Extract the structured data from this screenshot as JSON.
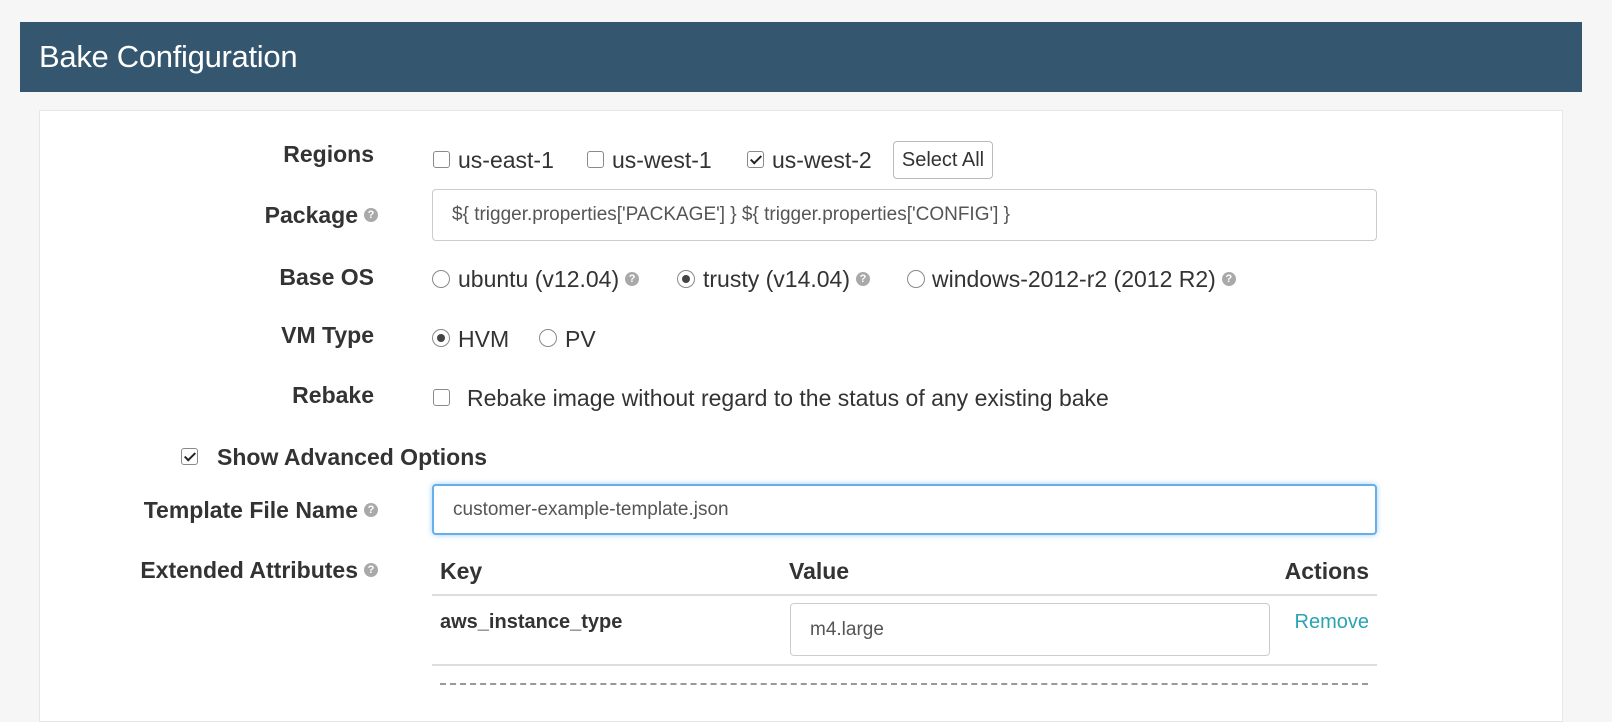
{
  "header": {
    "title": "Bake Configuration"
  },
  "regions": {
    "label": "Regions",
    "options": [
      {
        "label": "us-east-1",
        "checked": false
      },
      {
        "label": "us-west-1",
        "checked": false
      },
      {
        "label": "us-west-2",
        "checked": true
      }
    ],
    "select_all_label": "Select All"
  },
  "package": {
    "label": "Package",
    "value": "${ trigger.properties['PACKAGE'] } ${ trigger.properties['CONFIG'] }"
  },
  "base_os": {
    "label": "Base OS",
    "options": [
      {
        "label": "ubuntu (v12.04)",
        "selected": false
      },
      {
        "label": "trusty (v14.04)",
        "selected": true
      },
      {
        "label": "windows-2012-r2 (2012 R2)",
        "selected": false
      }
    ]
  },
  "vm_type": {
    "label": "VM Type",
    "options": [
      {
        "label": "HVM",
        "selected": true
      },
      {
        "label": "PV",
        "selected": false
      }
    ]
  },
  "rebake": {
    "label": "Rebake",
    "option_label": "Rebake image without regard to the status of any existing bake",
    "checked": false
  },
  "advanced": {
    "label": "Show Advanced Options",
    "checked": true
  },
  "template_file": {
    "label": "Template File Name",
    "value": "customer-example-template.json"
  },
  "extended_attributes": {
    "label": "Extended Attributes",
    "columns": [
      "Key",
      "Value",
      "Actions"
    ],
    "rows": [
      {
        "key": "aws_instance_type",
        "value": "m4.large",
        "action": "Remove"
      }
    ]
  },
  "icons": {
    "help": "question-circle-icon"
  },
  "colors": {
    "header_bg": "#34566e",
    "link": "#2aa3b3",
    "focus": "#66afe9"
  }
}
